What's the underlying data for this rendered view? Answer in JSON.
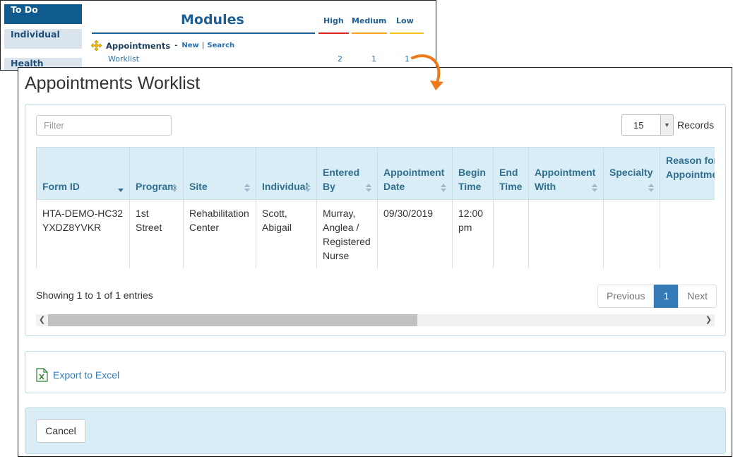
{
  "modules_panel": {
    "sidebar": [
      "To Do",
      "Individual",
      "Health"
    ],
    "title": "Modules",
    "priorities": [
      {
        "label": "High",
        "color": "#e02424"
      },
      {
        "label": "Medium",
        "color": "#f5a623"
      },
      {
        "label": "Low",
        "color": "#f5c623"
      }
    ],
    "appointments": {
      "label": "Appointments",
      "dash": "-",
      "new_link": "New",
      "separator": "|",
      "search_link": "Search",
      "worklist_link": "Worklist",
      "counts": [
        "2",
        "1",
        "1"
      ]
    },
    "arrow_color": "#f07a1a"
  },
  "dialog": {
    "title": "Appointments Worklist",
    "filter_placeholder": "Filter",
    "records_value": "15",
    "records_label": "Records",
    "columns": [
      "Form ID",
      "Program",
      "Site",
      "Individual",
      "Entered By",
      "Appointment Date",
      "Begin Time",
      "End Time",
      "Appointment With",
      "Specialty",
      "Reason for Appointment"
    ],
    "rows": [
      {
        "form_id": "HTA-DEMO-HC32YXDZ8YVKR",
        "program": "1st Street",
        "site": "Rehabilitation Center",
        "individual": "Scott, Abigail",
        "entered_by": "Murray, Anglea / Registered Nurse",
        "appointment_date": "09/30/2019",
        "begin_time": "12:00 pm",
        "end_time": "",
        "appointment_with": "",
        "specialty": "",
        "reason": ""
      }
    ],
    "showing_text": "Showing 1 to 1 of 1 entries",
    "pagination": {
      "previous": "Previous",
      "current": "1",
      "next": "Next"
    },
    "export_label": "Export to Excel",
    "cancel_label": "Cancel"
  }
}
